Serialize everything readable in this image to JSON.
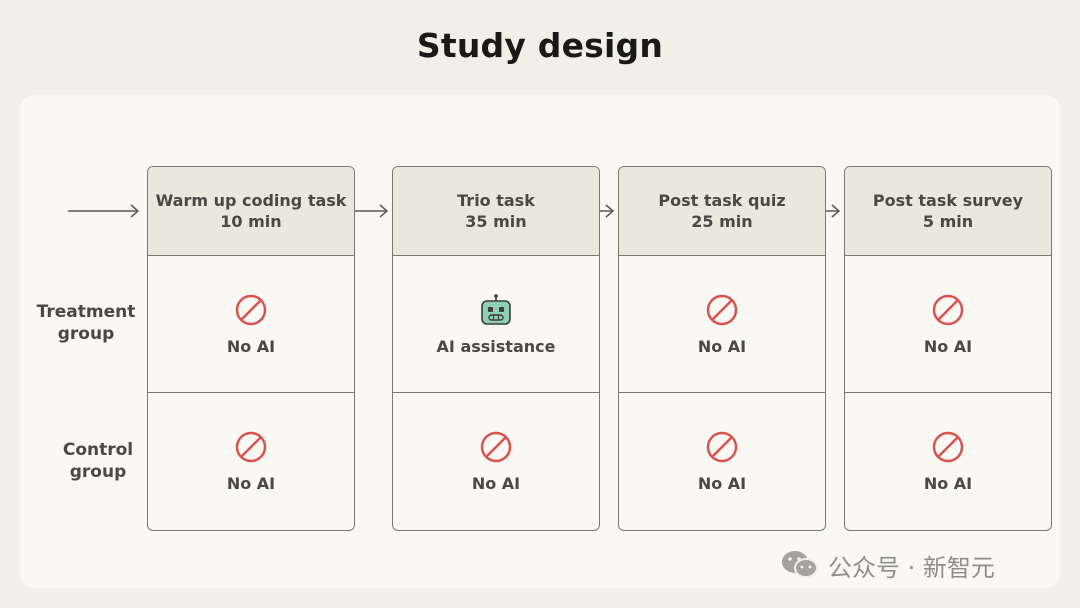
{
  "title": "Study design",
  "rows": {
    "treatment": "Treatment\ngroup",
    "control": "Control\ngroup"
  },
  "stages": [
    {
      "name": "Warm up coding task",
      "duration": "10 min",
      "treatment": {
        "label": "No AI",
        "icon": "no-icon"
      },
      "control": {
        "label": "No AI",
        "icon": "no-icon"
      }
    },
    {
      "name": "Trio task",
      "duration": "35 min",
      "treatment": {
        "label": "AI assistance",
        "icon": "robot-icon"
      },
      "control": {
        "label": "No AI",
        "icon": "no-icon"
      }
    },
    {
      "name": "Post task quiz",
      "duration": "25 min",
      "treatment": {
        "label": "No AI",
        "icon": "no-icon"
      },
      "control": {
        "label": "No AI",
        "icon": "no-icon"
      }
    },
    {
      "name": "Post task survey",
      "duration": "5 min",
      "treatment": {
        "label": "No AI",
        "icon": "no-icon"
      },
      "control": {
        "label": "No AI",
        "icon": "no-icon"
      }
    }
  ],
  "watermark": "公众号 · 新智元",
  "colors": {
    "no_icon": "#d9534f",
    "robot_icon": "#8fcfb6",
    "header_bg": "#e9e8dc",
    "border": "#7a7870"
  }
}
